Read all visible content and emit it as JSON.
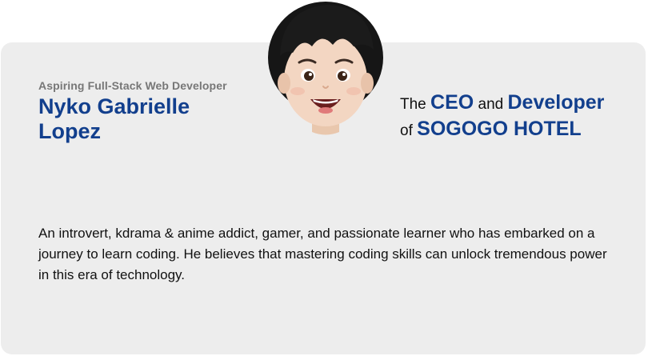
{
  "profile": {
    "subtitle": "Aspiring Full-Stack Web Developer",
    "name_line1": "Nyko Gabrielle",
    "name_line2": "Lopez",
    "avatar_icon": "memoji-avatar-icon"
  },
  "role": {
    "word_the": "The",
    "word_ceo": "CEO",
    "word_and": "and",
    "word_developer": "Developer",
    "word_of": "of",
    "company": "SOGOGO HOTEL"
  },
  "bio": {
    "text": "An introvert, kdrama & anime addict, gamer, and passionate learner who has embarked on a journey to learn coding. He believes that mastering coding skills can unlock tremendous power in this era of technology."
  },
  "colors": {
    "accent": "#123f8d",
    "card_bg": "#ededed",
    "subtitle": "#777777",
    "body_text": "#111111"
  }
}
